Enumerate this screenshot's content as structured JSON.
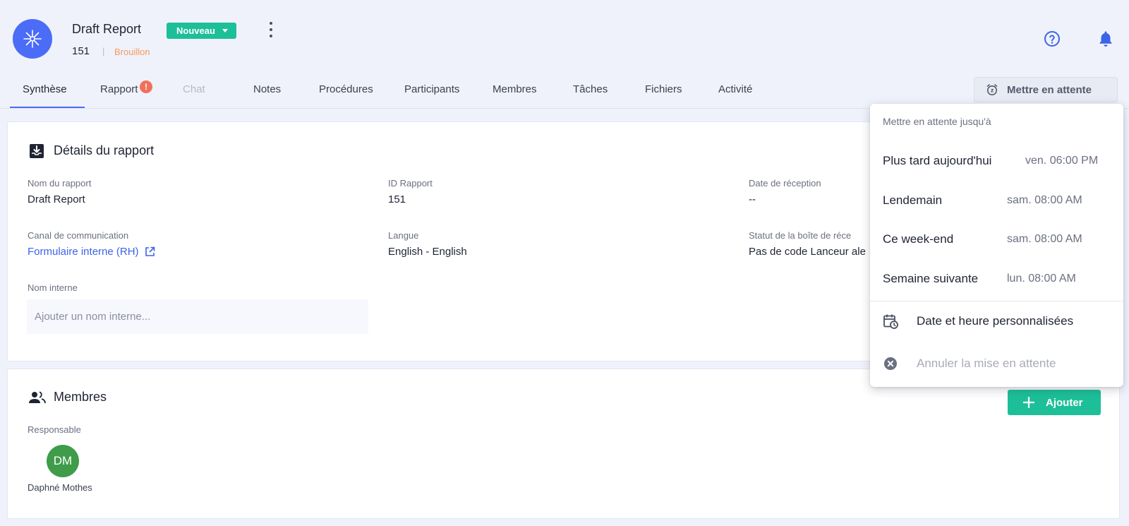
{
  "header": {
    "title": "Draft Report",
    "status_label": "Nouveau",
    "report_id": "151",
    "separator": "|",
    "draft_status": "Brouillon"
  },
  "tabs": [
    {
      "label": "Synthèse",
      "state": "active"
    },
    {
      "label": "Rapport",
      "badge": "!"
    },
    {
      "label": "Chat",
      "state": "disabled"
    },
    {
      "label": "Notes"
    },
    {
      "label": "Procédures"
    },
    {
      "label": "Participants"
    },
    {
      "label": "Membres"
    },
    {
      "label": "Tâches"
    },
    {
      "label": "Fichiers"
    },
    {
      "label": "Activité"
    }
  ],
  "snooze_button": {
    "label": "Mettre en attente"
  },
  "details": {
    "title": "Détails du rapport",
    "fields": {
      "name": {
        "label": "Nom du rapport",
        "value": "Draft Report"
      },
      "id": {
        "label": "ID Rapport",
        "value": "151"
      },
      "received": {
        "label": "Date de réception",
        "value": "--"
      },
      "channel": {
        "label": "Canal de communication",
        "value": "Formulaire interne (RH)"
      },
      "language": {
        "label": "Langue",
        "value": "English - English"
      },
      "inbox_status": {
        "label": "Statut de la boîte de réce",
        "value": "Pas de code Lanceur ale"
      },
      "internal_name": {
        "label": "Nom interne",
        "placeholder": "Ajouter un nom interne..."
      }
    }
  },
  "members": {
    "title": "Membres",
    "add_label": "Ajouter",
    "role_label": "Responsable",
    "member": {
      "initials": "DM",
      "name": "Daphné Mothes"
    }
  },
  "snooze_menu": {
    "header": "Mettre en attente jusqu'à",
    "options": [
      {
        "label": "Plus tard aujourd'hui",
        "time": "ven. 06:00 PM"
      },
      {
        "label": "Lendemain",
        "time": "sam. 08:00 AM"
      },
      {
        "label": "Ce week-end",
        "time": "sam. 08:00 AM"
      },
      {
        "label": "Semaine suivante",
        "time": "lun. 08:00 AM"
      }
    ],
    "custom_label": "Date et heure personnalisées",
    "cancel_label": "Annuler la mise en attente"
  },
  "colors": {
    "accent": "#4a6cf7",
    "success": "#1dbf98",
    "draft": "#f39a5c",
    "badge": "#f2705a",
    "avatar": "#3f9c4a",
    "link": "#3d63e8"
  }
}
